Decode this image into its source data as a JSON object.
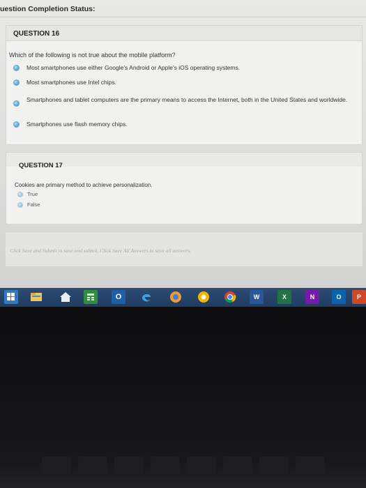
{
  "status": {
    "title": "uestion Completion Status:"
  },
  "questions": [
    {
      "title": "QUESTION 16",
      "prompt": "Which of the following is not true about the mobile platform?",
      "options": [
        "Most smartphones use either Google's Android or Apple's iOS operating systems.",
        "Most smartphones use Intel chips.",
        "Smartphones and tablet computers are the primary means to access the Internet, both in the United States and worldwide.",
        "Smartphones use flash memory chips."
      ]
    },
    {
      "title": "QUESTION 17",
      "prompt": "Cookies are primary method to achieve personalization.",
      "options": [
        "True",
        "False"
      ]
    }
  ],
  "footer": {
    "text": "Click Save and Submit to save and submit. Click Save All Answers to save all answers."
  },
  "taskbar": {
    "icons": [
      "windows-icon",
      "file-explorer-icon",
      "home-icon",
      "calculator-icon",
      "outlook-icon",
      "edge-icon",
      "photos-icon",
      "chrome-canary-icon",
      "chrome-icon",
      "word-icon",
      "excel-icon",
      "onenote-icon",
      "outlook-icon-2",
      "powerpoint-icon"
    ],
    "word_label": "W",
    "excel_label": "X",
    "onenote_label": "N",
    "outlook_label": "O",
    "powerpoint_label": "P"
  },
  "colors": {
    "taskbar": "#213d60",
    "radio": "#5fb0d6",
    "panel": "#f1f1ef"
  }
}
